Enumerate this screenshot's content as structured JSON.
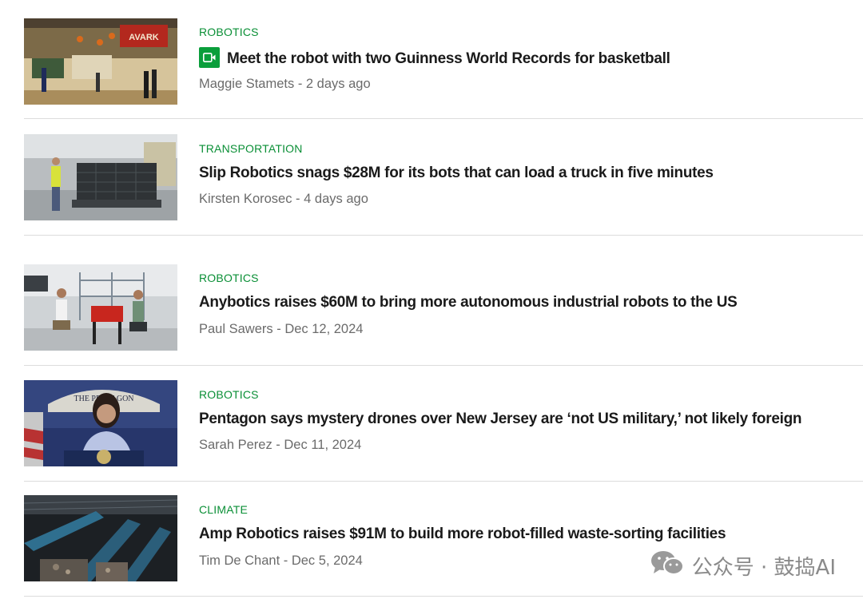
{
  "articles": [
    {
      "category": "ROBOTICS",
      "has_video_badge": true,
      "video_badge_icon": "video-camera-icon",
      "title": "Meet the robot with two Guinness World Records for basketball",
      "author": "Maggie Stamets",
      "separator": " - ",
      "date": "2 days ago",
      "thumb_sign": "AVARK"
    },
    {
      "category": "TRANSPORTATION",
      "has_video_badge": false,
      "title": "Slip Robotics snags $28M for its bots that can load a truck in five minutes",
      "author": "Kirsten Korosec",
      "separator": " - ",
      "date": "4 days ago"
    },
    {
      "category": "ROBOTICS",
      "has_video_badge": false,
      "title": "Anybotics raises $60M to bring more autonomous industrial robots to the US",
      "author": "Paul Sawers",
      "separator": " - ",
      "date": "Dec 12, 2024"
    },
    {
      "category": "ROBOTICS",
      "has_video_badge": false,
      "title": "Pentagon says mystery drones over New Jersey are ‘not US military,’ not likely foreign",
      "author": "Sarah Perez",
      "separator": " - ",
      "date": "Dec 11, 2024",
      "thumb_sign": "THE PENTAGON"
    },
    {
      "category": "CLIMATE",
      "has_video_badge": false,
      "title": "Amp Robotics raises $91M to build more robot-filled waste-sorting facilities",
      "author": "Tim De Chant",
      "separator": " - ",
      "date": "Dec 5, 2024"
    }
  ],
  "watermark": {
    "icon": "wechat-icon",
    "text": "公众号 · 鼓捣AI"
  },
  "colors": {
    "category": "#0a8f36",
    "title": "#1a1a1a",
    "byline": "#6b6b6b",
    "divider": "#dcdcdc",
    "video_badge": "#0a9e3b"
  }
}
